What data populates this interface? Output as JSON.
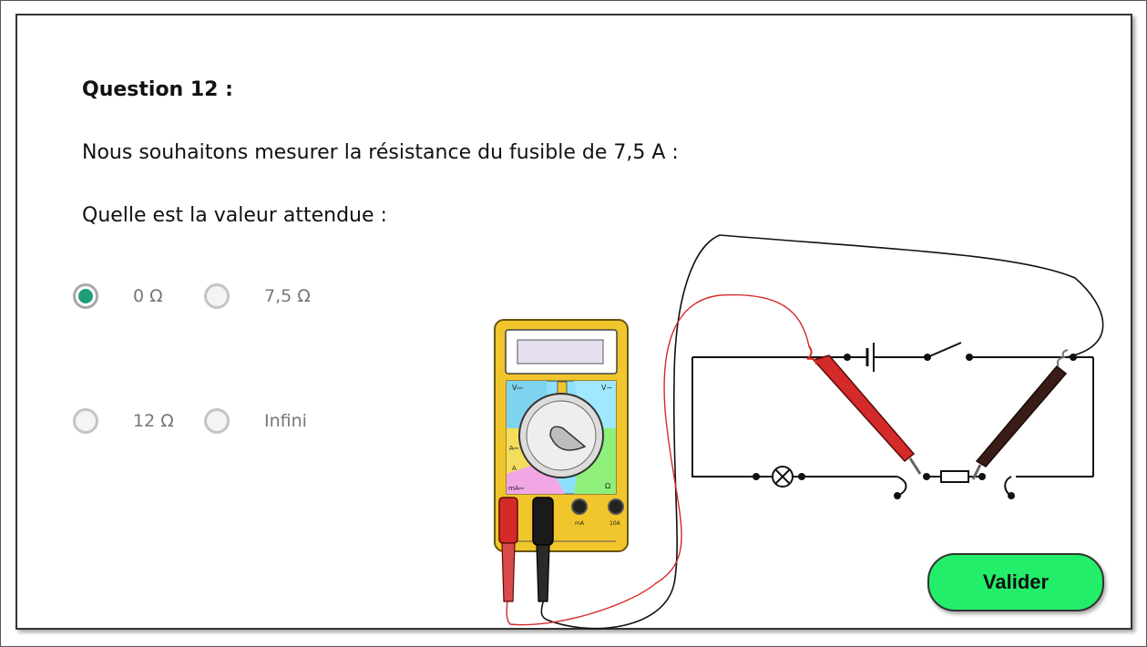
{
  "question": {
    "title": "Question 12 :",
    "text": "Nous souhaitons mesurer la résistance du fusible de 7,5 A :",
    "prompt": "Quelle est la valeur attendue :"
  },
  "options": [
    {
      "label": "0 Ω",
      "selected": true
    },
    {
      "label": "7,5 Ω",
      "selected": false
    },
    {
      "label": "12 Ω",
      "selected": false
    },
    {
      "label": "Infini",
      "selected": false
    }
  ],
  "multimeter": {
    "ranges": [
      "V⎓",
      "V∼",
      "A⎓",
      "A",
      "mA⎓",
      "Ω"
    ],
    "sockets": [
      "mA",
      "10A"
    ]
  },
  "submit_label": "Valider",
  "colors": {
    "accent": "#1f9e7a",
    "button": "#22ee6a",
    "probe_red": "#d42a2a",
    "probe_black": "#3a1c16"
  }
}
